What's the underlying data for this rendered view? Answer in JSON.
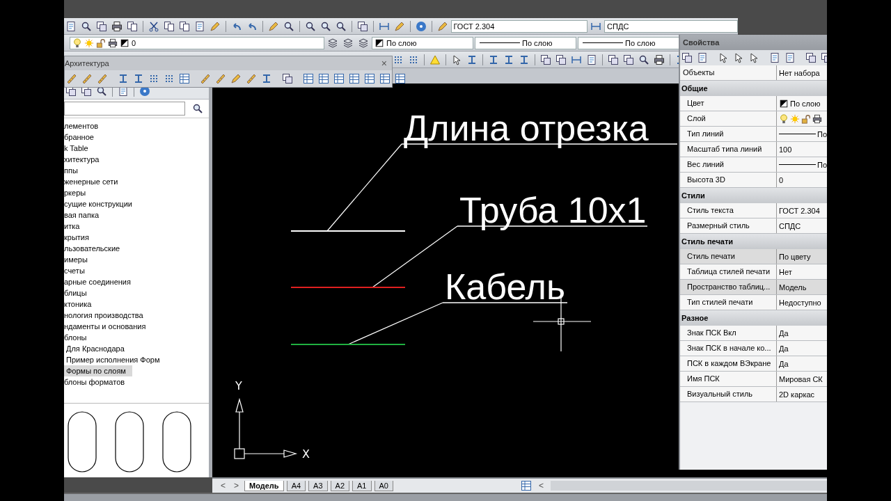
{
  "toolbar": {
    "text_style": "ГОСТ 2.304",
    "dim_style": "СПДС"
  },
  "layer_bar": {
    "layer": "0",
    "color_value": "По слою",
    "linetype": "По слою",
    "lineweight": "По слою"
  },
  "arch_toolbar": {
    "title": "Архитектура",
    "close": "×"
  },
  "tool_palette": {
    "items": [
      {
        "label": "лементов",
        "selected": false
      },
      {
        "label": "бранное",
        "selected": false
      },
      {
        "label": "k Table",
        "selected": false
      },
      {
        "label": "хитектура",
        "selected": false
      },
      {
        "label": "ппы",
        "selected": false
      },
      {
        "label": "женерные сети",
        "selected": false
      },
      {
        "label": "ркеры",
        "selected": false
      },
      {
        "label": "сущие конструкции",
        "selected": false
      },
      {
        "label": "вая папка",
        "selected": false
      },
      {
        "label": "итка",
        "selected": false
      },
      {
        "label": "крытия",
        "selected": false
      },
      {
        "label": "льзовательские",
        "selected": false
      },
      {
        "label": "имеры",
        "selected": false
      },
      {
        "label": "счеты",
        "selected": false
      },
      {
        "label": "арные соединения",
        "selected": false
      },
      {
        "label": "блицы",
        "selected": false
      },
      {
        "label": "ктоника",
        "selected": false
      },
      {
        "label": "нология производства",
        "selected": false
      },
      {
        "label": "ндаменты и основания",
        "selected": false
      },
      {
        "label": "блоны",
        "selected": false,
        "children": [
          {
            "label": "Для Краснодара",
            "selected": false
          },
          {
            "label": "Пример исполнения Форм",
            "selected": false
          },
          {
            "label": "Формы по слоям",
            "selected": true
          }
        ]
      },
      {
        "label": "блоны форматов",
        "selected": false
      }
    ]
  },
  "drawing": {
    "annotations": [
      {
        "text": "Длина отрезка"
      },
      {
        "text": "Труба 10x1"
      },
      {
        "text": "Кабель"
      }
    ],
    "lines": [
      {
        "color": "#ffffff"
      },
      {
        "color": "#e02020"
      },
      {
        "color": "#20b040"
      }
    ],
    "ucs": {
      "x": "X",
      "y": "Y"
    }
  },
  "properties": {
    "title": "Свойства",
    "selection": {
      "label": "Объекты",
      "value": "Нет набора"
    },
    "sections": [
      {
        "title": "Общие",
        "rows": [
          {
            "label": "Цвет",
            "value": "По слою",
            "kind": "color",
            "disabled": false
          },
          {
            "label": "Слой",
            "kind": "layer",
            "disabled": false
          },
          {
            "label": "Тип линий",
            "value": "По",
            "kind": "line",
            "disabled": false
          },
          {
            "label": "Масштаб типа линий",
            "value": "100",
            "kind": "text",
            "disabled": false
          },
          {
            "label": "Вес линий",
            "value": "По",
            "kind": "line",
            "disabled": false
          },
          {
            "label": "Высота 3D",
            "value": "0",
            "kind": "text",
            "disabled": false
          }
        ]
      },
      {
        "title": "Стили",
        "rows": [
          {
            "label": "Стиль текста",
            "value": "ГОСТ 2.304",
            "kind": "text",
            "disabled": false
          },
          {
            "label": "Размерный стиль",
            "value": "СПДС",
            "kind": "text",
            "disabled": false
          }
        ]
      },
      {
        "title": "Стиль печати",
        "rows": [
          {
            "label": "Стиль печати",
            "value": "По цвету",
            "kind": "text",
            "disabled": true
          },
          {
            "label": "Таблица стилей печати",
            "value": "Нет",
            "kind": "text",
            "disabled": false
          },
          {
            "label": "Пространство таблиц...",
            "value": "Модель",
            "kind": "text",
            "disabled": true
          },
          {
            "label": "Тип стилей печати",
            "value": "Недоступно",
            "kind": "text",
            "disabled": false
          }
        ]
      },
      {
        "title": "Разное",
        "rows": [
          {
            "label": "Знак ПСК Вкл",
            "value": "Да",
            "kind": "text",
            "disabled": false
          },
          {
            "label": "Знак ПСК в начале ко...",
            "value": "Да",
            "kind": "text",
            "disabled": false
          },
          {
            "label": "ПСК в каждом ВЭкране",
            "value": "Да",
            "kind": "text",
            "disabled": false
          },
          {
            "label": "Имя ПСК",
            "value": "Мировая СК",
            "kind": "text",
            "disabled": false
          },
          {
            "label": "Визуальный стиль",
            "value": "2D каркас",
            "kind": "text",
            "disabled": false
          }
        ]
      }
    ]
  },
  "layout_tabs": {
    "nav": [
      "<",
      ">"
    ],
    "items": [
      {
        "label": "Модель",
        "selected": true
      },
      {
        "label": "A4",
        "selected": false
      },
      {
        "label": "A3",
        "selected": false
      },
      {
        "label": "A2",
        "selected": false
      },
      {
        "label": "A1",
        "selected": false
      },
      {
        "label": "A0",
        "selected": false
      }
    ],
    "scroll_left": "<"
  }
}
